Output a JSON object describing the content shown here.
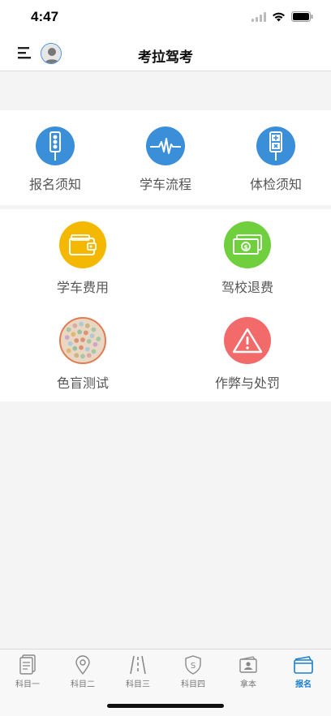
{
  "status": {
    "time": "4:47"
  },
  "navbar": {
    "title": "考拉驾考"
  },
  "top_items": [
    {
      "label": "报名须知",
      "icon": "traffic-light-icon",
      "color": "#3b8fd9"
    },
    {
      "label": "学车流程",
      "icon": "pulse-icon",
      "color": "#3b8fd9"
    },
    {
      "label": "体检须知",
      "icon": "medical-check-icon",
      "color": "#3b8fd9"
    }
  ],
  "main_items": [
    {
      "label": "学车费用",
      "icon": "wallet-icon",
      "color": "#f5b800"
    },
    {
      "label": "驾校退费",
      "icon": "money-icon",
      "color": "#6fcf3c"
    },
    {
      "label": "色盲测试",
      "icon": "color-blind-test-icon",
      "color": "#e07b54"
    },
    {
      "label": "作弊与处罚",
      "icon": "warning-icon",
      "color": "#f26a6a"
    }
  ],
  "tabbar": {
    "tabs": [
      {
        "label": "科目一",
        "icon": "document-icon",
        "active": false
      },
      {
        "label": "科目二",
        "icon": "location-pin-icon",
        "active": false
      },
      {
        "label": "科目三",
        "icon": "road-icon",
        "active": false
      },
      {
        "label": "科目四",
        "icon": "shield-icon",
        "active": false
      },
      {
        "label": "拿本",
        "icon": "license-icon",
        "active": false
      },
      {
        "label": "报名",
        "icon": "signup-card-icon",
        "active": true
      }
    ]
  },
  "colors": {
    "active_tab": "#1a7fd0",
    "accent_blue": "#3b8fd9"
  }
}
